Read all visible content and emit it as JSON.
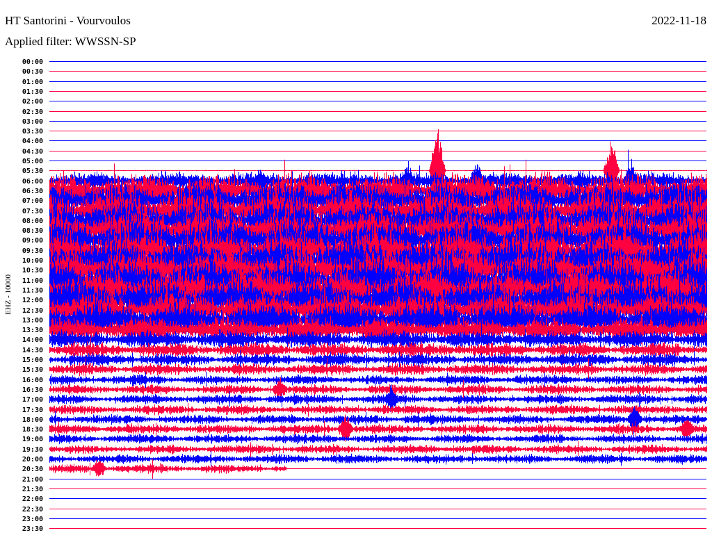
{
  "header": {
    "station": "HT Santorini - Vourvoulos",
    "filter": "Applied filter: WWSSN-SP",
    "date": "2022-11-18"
  },
  "chart_data": {
    "type": "line",
    "title": "HT Santorini - Vourvoulos",
    "subtitle": "Applied filter: WWSSN-SP",
    "ylabel": "EHZ - 10000",
    "xlabel": "",
    "row_colors": [
      "#0000ff",
      "#ff0040"
    ],
    "rows": [
      {
        "label": "00:00",
        "amp": 0
      },
      {
        "label": "00:30",
        "amp": 0
      },
      {
        "label": "01:00",
        "amp": 0
      },
      {
        "label": "01:30",
        "amp": 0
      },
      {
        "label": "02:00",
        "amp": 0
      },
      {
        "label": "02:30",
        "amp": 0
      },
      {
        "label": "03:00",
        "amp": 0
      },
      {
        "label": "03:30",
        "amp": 0
      },
      {
        "label": "04:00",
        "amp": 0
      },
      {
        "label": "04:30",
        "amp": 0
      },
      {
        "label": "05:00",
        "amp": 0
      },
      {
        "label": "05:30",
        "amp": 0
      },
      {
        "label": "06:00",
        "amp": 0.55
      },
      {
        "label": "06:30",
        "amp": 1.1
      },
      {
        "label": "07:00",
        "amp": 1.2
      },
      {
        "label": "07:30",
        "amp": 1.3
      },
      {
        "label": "08:00",
        "amp": 1.3
      },
      {
        "label": "08:30",
        "amp": 1.3
      },
      {
        "label": "09:00",
        "amp": 1.3
      },
      {
        "label": "09:30",
        "amp": 1.3
      },
      {
        "label": "10:00",
        "amp": 1.3
      },
      {
        "label": "10:30",
        "amp": 1.35
      },
      {
        "label": "11:00",
        "amp": 1.35
      },
      {
        "label": "11:30",
        "amp": 1.35
      },
      {
        "label": "12:00",
        "amp": 1.3
      },
      {
        "label": "12:30",
        "amp": 1.25
      },
      {
        "label": "13:00",
        "amp": 1.1
      },
      {
        "label": "13:30",
        "amp": 0.8
      },
      {
        "label": "14:00",
        "amp": 0.55
      },
      {
        "label": "14:30",
        "amp": 0.45
      },
      {
        "label": "15:00",
        "amp": 0.4
      },
      {
        "label": "15:30",
        "amp": 0.35
      },
      {
        "label": "16:00",
        "amp": 0.3
      },
      {
        "label": "16:30",
        "amp": 0.3
      },
      {
        "label": "17:00",
        "amp": 0.3
      },
      {
        "label": "17:30",
        "amp": 0.3
      },
      {
        "label": "18:00",
        "amp": 0.3
      },
      {
        "label": "18:30",
        "amp": 0.3
      },
      {
        "label": "19:00",
        "amp": 0.28
      },
      {
        "label": "19:30",
        "amp": 0.28
      },
      {
        "label": "20:00",
        "amp": 0.28
      },
      {
        "label": "20:30",
        "amp": 0.28,
        "data_end": 0.36
      },
      {
        "label": "21:00",
        "amp": 0
      },
      {
        "label": "21:30",
        "amp": 0
      },
      {
        "label": "22:00",
        "amp": 0
      },
      {
        "label": "22:30",
        "amp": 0
      },
      {
        "label": "23:00",
        "amp": 0
      },
      {
        "label": "23:30",
        "amp": 0
      }
    ],
    "events": [
      {
        "row": "05:30",
        "at": 0.59,
        "amp": 4.5
      },
      {
        "row": "05:30",
        "at": 0.855,
        "amp": 3.0
      },
      {
        "row": "06:00",
        "at": 0.32,
        "amp": 1.5
      },
      {
        "row": "06:00",
        "at": 0.545,
        "amp": 1.8
      },
      {
        "row": "06:00",
        "at": 0.65,
        "amp": 2.2
      },
      {
        "row": "06:00",
        "at": 0.885,
        "amp": 2.2
      },
      {
        "row": "16:30",
        "at": 0.35,
        "amp": 1.2
      },
      {
        "row": "17:00",
        "at": 0.52,
        "amp": 1.3
      },
      {
        "row": "18:00",
        "at": 0.89,
        "amp": 1.6
      },
      {
        "row": "18:30",
        "at": 0.45,
        "amp": 1.5
      },
      {
        "row": "18:30",
        "at": 0.97,
        "amp": 1.3
      },
      {
        "row": "20:30",
        "at": 0.075,
        "amp": 1.0
      }
    ]
  }
}
